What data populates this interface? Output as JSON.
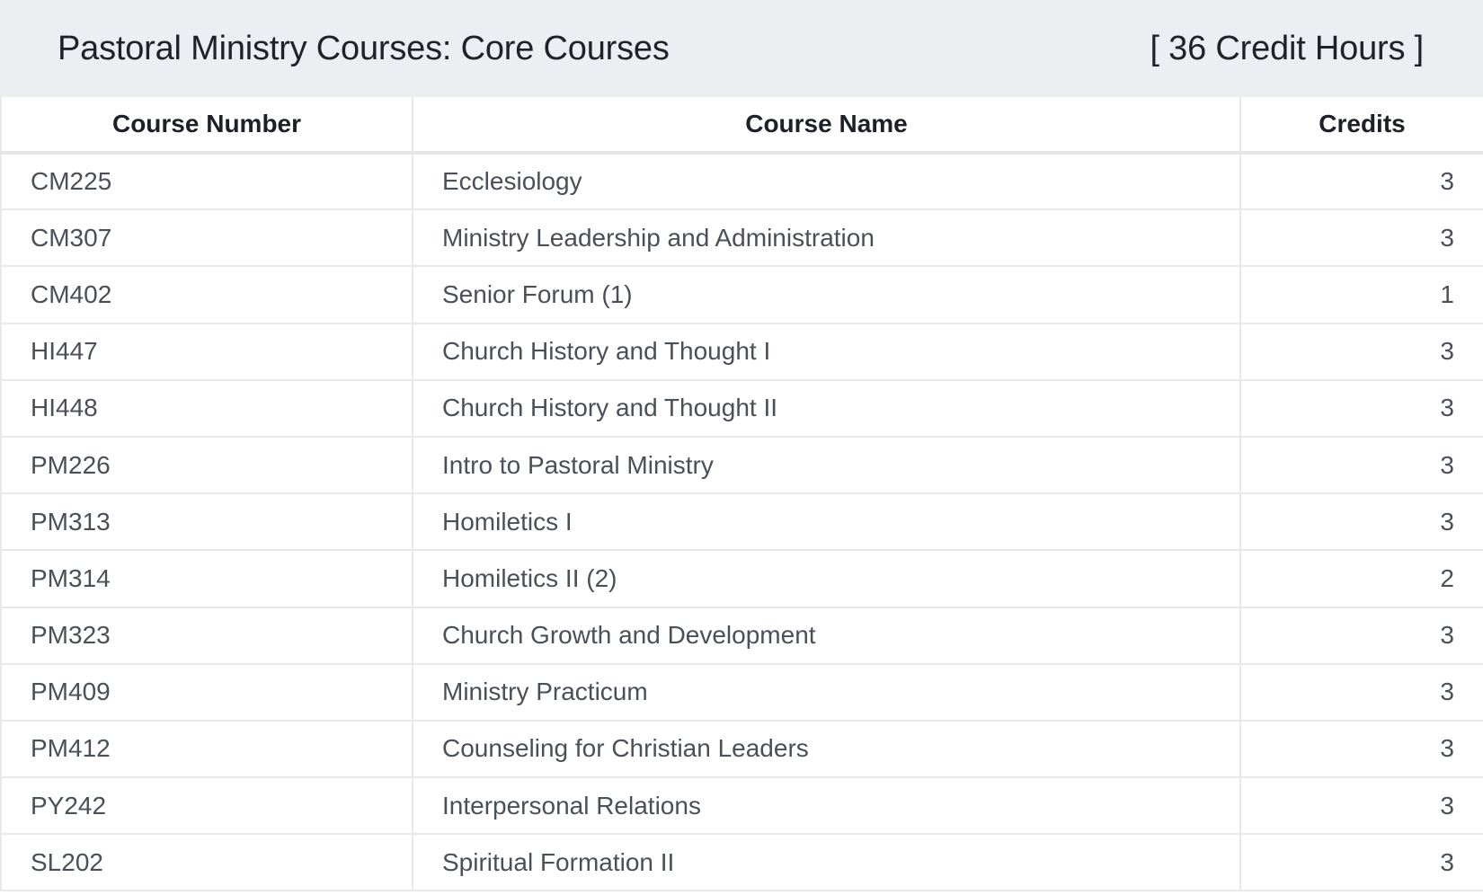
{
  "header": {
    "title": "Pastoral Ministry Courses: Core Courses",
    "credit_hours": "[ 36 Credit Hours ]"
  },
  "table": {
    "columns": [
      "Course Number",
      "Course Name",
      "Credits"
    ],
    "rows": [
      {
        "number": "CM225",
        "name": "Ecclesiology",
        "credits": "3"
      },
      {
        "number": "CM307",
        "name": "Ministry Leadership and Administration",
        "credits": "3"
      },
      {
        "number": "CM402",
        "name": "Senior Forum (1)",
        "credits": "1"
      },
      {
        "number": "HI447",
        "name": "Church History and Thought I",
        "credits": "3"
      },
      {
        "number": "HI448",
        "name": "Church History and Thought II",
        "credits": "3"
      },
      {
        "number": "PM226",
        "name": "Intro to Pastoral Ministry",
        "credits": "3"
      },
      {
        "number": "PM313",
        "name": "Homiletics I",
        "credits": "3"
      },
      {
        "number": "PM314",
        "name": "Homiletics II (2)",
        "credits": "2"
      },
      {
        "number": "PM323",
        "name": "Church Growth and Development",
        "credits": "3"
      },
      {
        "number": "PM409",
        "name": "Ministry Practicum",
        "credits": "3"
      },
      {
        "number": "PM412",
        "name": "Counseling for Christian Leaders",
        "credits": "3"
      },
      {
        "number": "PY242",
        "name": "Interpersonal Relations",
        "credits": "3"
      },
      {
        "number": "SL202",
        "name": "Spiritual Formation II",
        "credits": "3"
      }
    ]
  },
  "colors": {
    "header_background": "#eceef1",
    "title_text": "#1f2329",
    "cell_text": "#4a5058",
    "grid_line": "#e6e8eb"
  }
}
